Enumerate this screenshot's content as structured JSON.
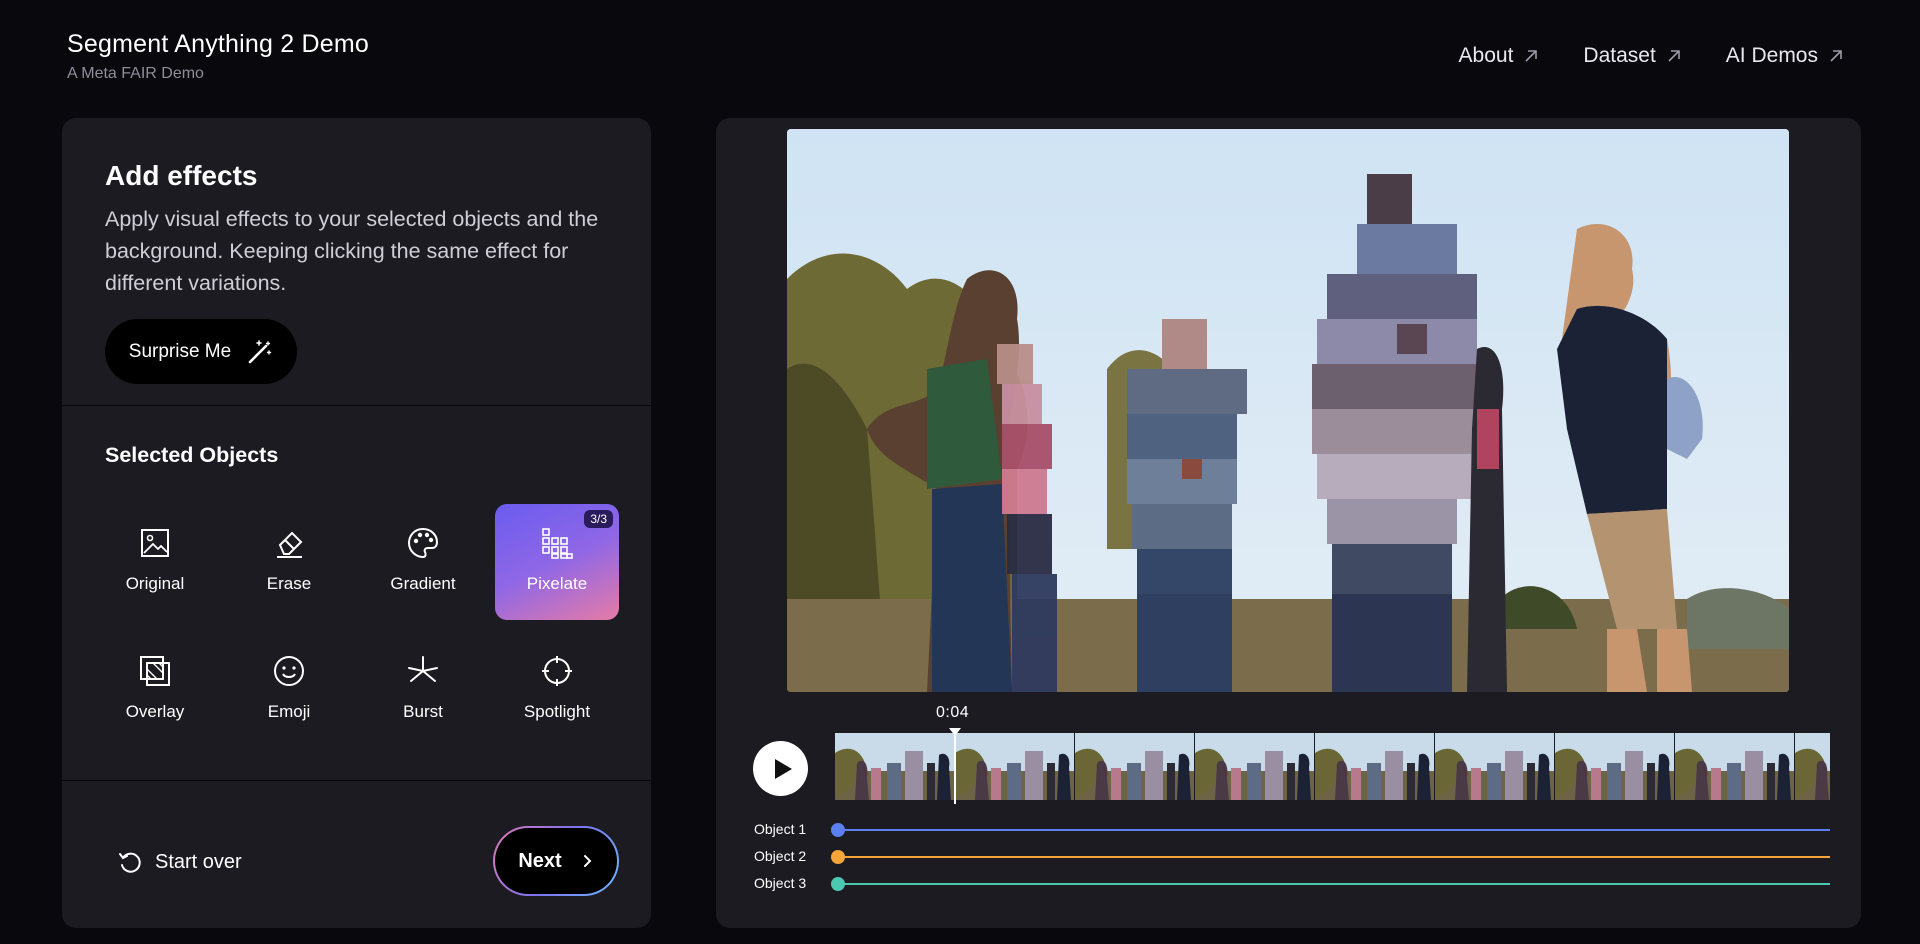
{
  "header": {
    "title": "Segment Anything 2 Demo",
    "subtitle": "A Meta FAIR Demo",
    "nav": [
      {
        "label": "About",
        "icon": "external-arrow-icon"
      },
      {
        "label": "Dataset",
        "icon": "external-arrow-icon"
      },
      {
        "label": "AI Demos",
        "icon": "external-arrow-icon"
      }
    ]
  },
  "effects_panel": {
    "title": "Add effects",
    "description": "Apply visual effects to your selected objects and the background. Keeping clicking the same effect for different variations.",
    "surprise_label": "Surprise Me",
    "selected_title": "Selected Objects",
    "effects": [
      {
        "label": "Original",
        "icon": "image-icon"
      },
      {
        "label": "Erase",
        "icon": "eraser-icon"
      },
      {
        "label": "Gradient",
        "icon": "palette-icon"
      },
      {
        "label": "Pixelate",
        "icon": "pixelate-icon",
        "active": true,
        "badge": "3/3"
      },
      {
        "label": "Overlay",
        "icon": "overlay-icon"
      },
      {
        "label": "Emoji",
        "icon": "emoji-icon"
      },
      {
        "label": "Burst",
        "icon": "burst-icon"
      },
      {
        "label": "Spotlight",
        "icon": "spotlight-icon"
      }
    ],
    "start_over_label": "Start over",
    "next_label": "Next"
  },
  "player": {
    "timecode": "0:04",
    "tracks": [
      {
        "label": "Object 1",
        "color": "#5b7ff0"
      },
      {
        "label": "Object 2",
        "color": "#f5a53a"
      },
      {
        "label": "Object 3",
        "color": "#4cc7b0"
      }
    ]
  }
}
